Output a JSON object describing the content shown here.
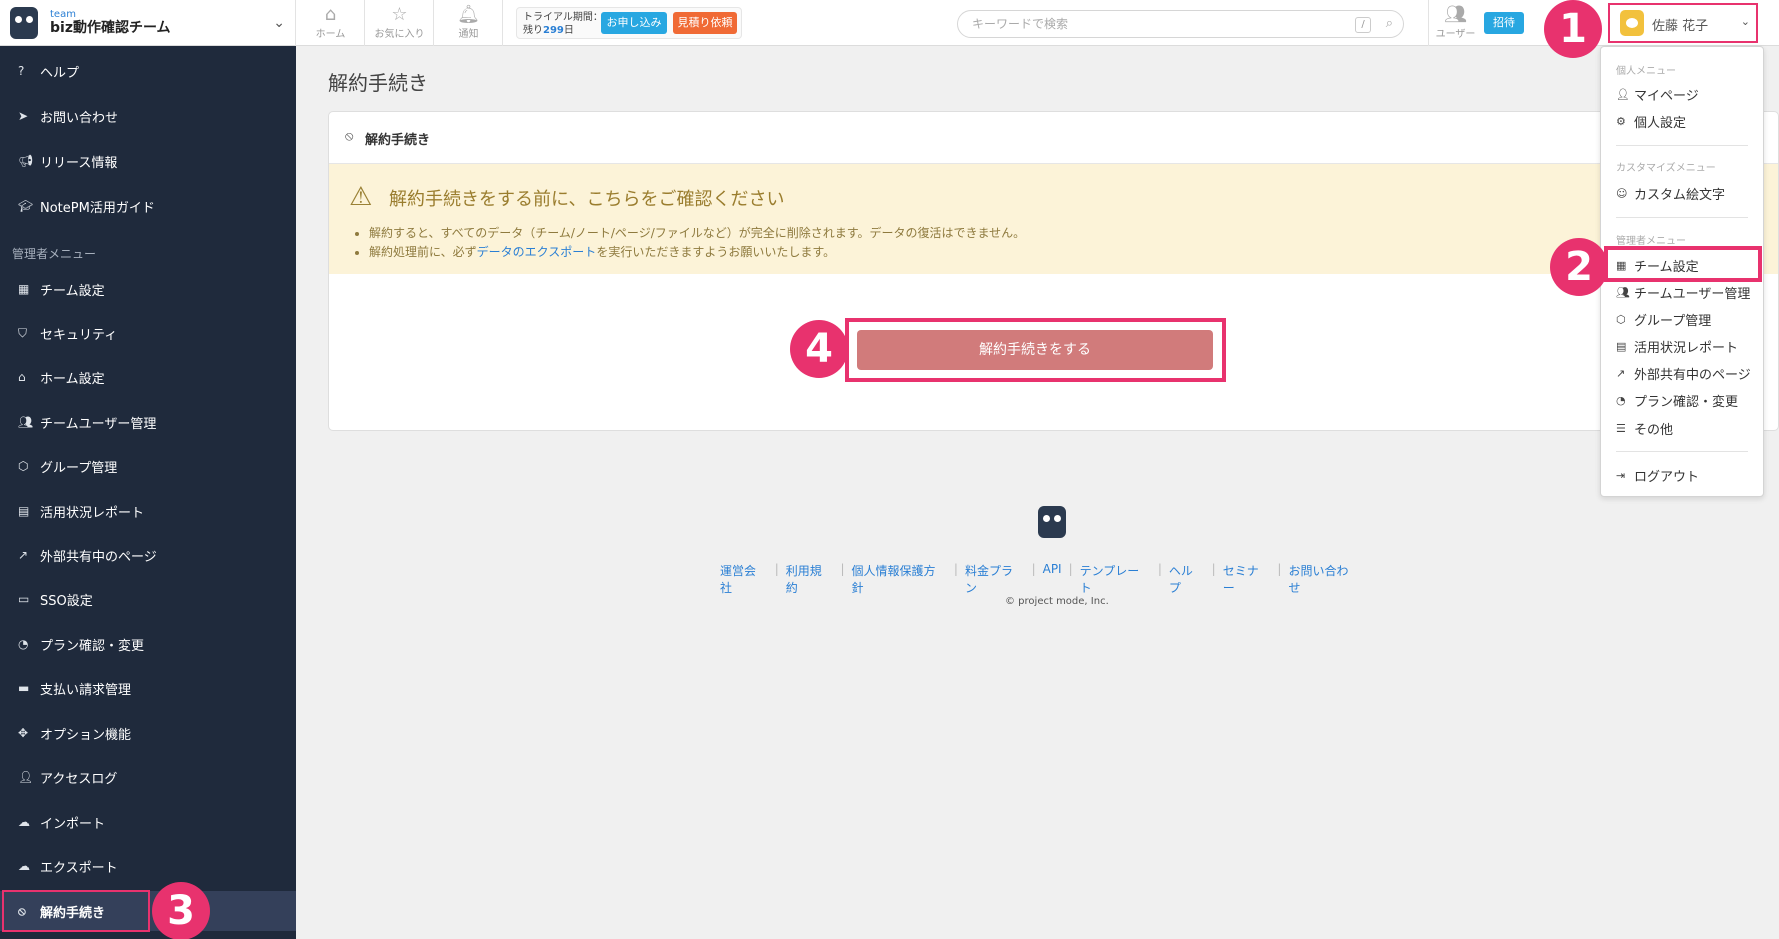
{
  "header": {
    "team_small": "team",
    "team_name": "biz動作確認チーム",
    "nav": {
      "home": "ホーム",
      "favorites": "お気に入り",
      "notifications": "通知"
    },
    "trial": {
      "label": "トライアル期間：",
      "remaining_prefix": "残り",
      "days": "299",
      "days_suffix": "日",
      "apply_label": "お申し込み",
      "quote_label": "見積り依頼"
    },
    "search_placeholder": "キーワードで検索",
    "search_shortcut": "/",
    "users_label": "ユーザー",
    "invite_label": "招待",
    "user_name": "佐藤 花子"
  },
  "sidebar": {
    "items_top": [
      {
        "label": "ヘルプ",
        "icon": "question-icon"
      },
      {
        "label": "お問い合わせ",
        "icon": "send-icon"
      },
      {
        "label": "リリース情報",
        "icon": "megaphone-icon"
      },
      {
        "label": "NotePM活用ガイド",
        "icon": "graduation-icon"
      }
    ],
    "admin_heading": "管理者メニュー",
    "items_admin": [
      {
        "label": "チーム設定",
        "icon": "building-icon"
      },
      {
        "label": "セキュリティ",
        "icon": "shield-icon"
      },
      {
        "label": "ホーム設定",
        "icon": "home-icon"
      },
      {
        "label": "チームユーザー管理",
        "icon": "users-icon"
      },
      {
        "label": "グループ管理",
        "icon": "cube-icon"
      },
      {
        "label": "活用状況レポート",
        "icon": "report-icon"
      },
      {
        "label": "外部共有中のページ",
        "icon": "external-link-icon"
      },
      {
        "label": "SSO設定",
        "icon": "id-card-icon"
      },
      {
        "label": "プラン確認・変更",
        "icon": "gauge-icon"
      },
      {
        "label": "支払い請求管理",
        "icon": "credit-card-icon"
      },
      {
        "label": "オプション機能",
        "icon": "puzzle-icon"
      },
      {
        "label": "アクセスログ",
        "icon": "user-clock-icon"
      },
      {
        "label": "インポート",
        "icon": "cloud-upload-icon"
      },
      {
        "label": "エクスポート",
        "icon": "cloud-download-icon"
      },
      {
        "label": "解約手続き",
        "icon": "ban-icon"
      }
    ]
  },
  "main": {
    "page_title": "解約手続き",
    "card_title": "解約手続き",
    "warning_title": "解約手続きをする前に、こちらをご確認ください",
    "warning_line1": "解約すると、すべてのデータ（チーム/ノート/ページ/ファイルなど）が完全に削除されます。データの復活はできません。",
    "warning_line2_before": "解約処理前に、必ず",
    "warning_line2_link": "データのエクスポート",
    "warning_line2_after": "を実行いただきますようお願いいたします。",
    "cancel_button": "解約手続きをする"
  },
  "footer": {
    "links": [
      "運営会社",
      "利用規約",
      "個人情報保護方針",
      "料金プラン",
      "API",
      "テンプレート",
      "ヘルプ",
      "セミナー",
      "お問い合わせ"
    ],
    "copyright": "© project mode, Inc."
  },
  "dropdown": {
    "personal_heading": "個人メニュー",
    "personal_items": [
      "マイページ",
      "個人設定"
    ],
    "custom_heading": "カスタマイズメニュー",
    "custom_items": [
      "カスタム絵文字"
    ],
    "admin_heading": "管理者メニュー",
    "admin_items": [
      "チーム設定",
      "チームユーザー管理",
      "グループ管理",
      "活用状況レポート",
      "外部共有中のページ",
      "プラン確認・変更",
      "その他"
    ],
    "logout": "ログアウト"
  },
  "steps": [
    "1",
    "2",
    "3",
    "4"
  ],
  "colors": {
    "highlight": "#e8326e",
    "sidebar_bg": "#1f2a3c",
    "warning_bg": "#fcf3d8",
    "cancel_button": "#d17b7b",
    "accent_blue": "#28a7e1",
    "accent_orange": "#f06a35"
  }
}
